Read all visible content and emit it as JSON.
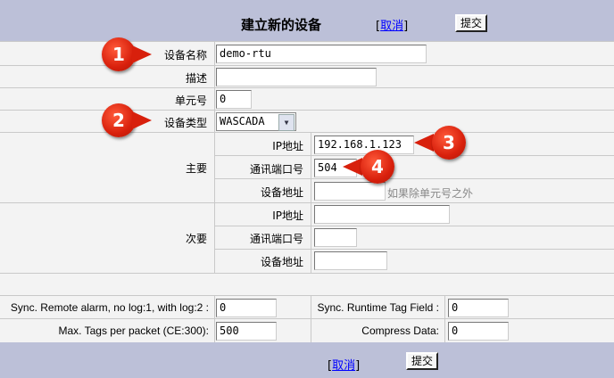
{
  "header": {
    "title": "建立新的设备",
    "cancel_open": "[",
    "cancel_label": "取消",
    "cancel_close": "]",
    "submit_label": "提交"
  },
  "fields": {
    "device_name": {
      "label": "设备名称",
      "value": "demo-rtu"
    },
    "description": {
      "label": "描述",
      "value": ""
    },
    "unit_no": {
      "label": "单元号",
      "value": "0"
    },
    "device_type": {
      "label": "设备类型",
      "value": "WASCADA"
    }
  },
  "primary": {
    "group_label": "主要",
    "ip": {
      "label": "IP地址",
      "value": "192.168.1.123"
    },
    "port": {
      "label": "通讯端口号",
      "value": "504"
    },
    "address": {
      "label": "设备地址",
      "value": "",
      "hint": "如果除单元号之外"
    }
  },
  "secondary": {
    "group_label": "次要",
    "ip": {
      "label": "IP地址",
      "value": ""
    },
    "port": {
      "label": "通讯端口号",
      "value": ""
    },
    "address": {
      "label": "设备地址",
      "value": ""
    }
  },
  "options": {
    "sync_remote_alarm": {
      "label": "Sync. Remote alarm, no log:1, with log:2 :",
      "value": "0"
    },
    "sync_runtime_tag": {
      "label": "Sync. Runtime Tag Field :",
      "value": "0"
    },
    "max_tags": {
      "label": "Max. Tags per packet (CE:300):",
      "value": "500"
    },
    "compress": {
      "label": "Compress Data:",
      "value": "0"
    }
  },
  "footer": {
    "cancel_open": "[",
    "cancel_label": "取消",
    "cancel_close": "]",
    "submit_label": "提交"
  },
  "callouts": [
    "1",
    "2",
    "3",
    "4"
  ],
  "colors": {
    "header_bg": "#bcc0d8",
    "callout": "#d8200c",
    "link": "#0000ff"
  }
}
